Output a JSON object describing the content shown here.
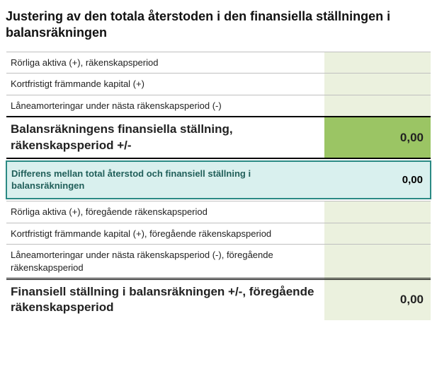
{
  "title": "Justering av den totala återstoden i den finansiella ställningen i balansräkningen",
  "rows": {
    "r1": {
      "label": "Rörliga aktiva (+), räkenskapsperiod",
      "value": ""
    },
    "r2": {
      "label": "Kortfristigt främmande kapital (+)",
      "value": ""
    },
    "r3": {
      "label": "Låneamorteringar under nästa räkenskapsperiod (-)",
      "value": ""
    },
    "total1": {
      "label": "Balansräkningens finansiella ställning, räkenskapsperiod +/-",
      "value": "0,00"
    },
    "diff": {
      "label": "Differens mellan total återstod och finansiell ställning i balansräkningen",
      "value": "0,00"
    },
    "r4": {
      "label": "Rörliga aktiva (+), föregående räkenskapsperiod",
      "value": ""
    },
    "r5": {
      "label": "Kortfristigt främmande kapital (+), föregående räkenskapsperiod",
      "value": ""
    },
    "r6": {
      "label": "Låneamorteringar under nästa räkenskapsperiod (-), föregående räkenskapsperiod",
      "value": ""
    },
    "total2": {
      "label": "Finansiell ställning i balansräkningen +/-, föregående räkenskapsperiod",
      "value": "0,00"
    }
  }
}
